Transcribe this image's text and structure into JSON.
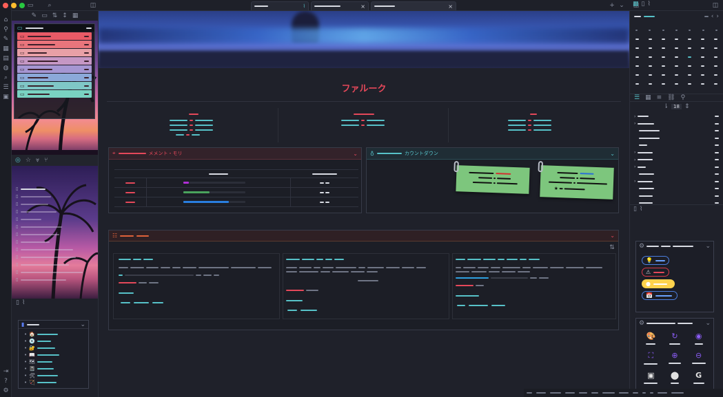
{
  "window": {
    "traffic_lights": [
      "#ff5f57",
      "#febc2e",
      "#28c840"
    ]
  },
  "rail_icons": [
    "home-icon",
    "graph-icon",
    "edit-icon",
    "calendar-icon",
    "book-icon",
    "globe-icon",
    "search-icon",
    "database-icon",
    "clipboard-icon"
  ],
  "rail_bottom_icons": [
    "vault-icon",
    "help-icon",
    "settings-icon"
  ],
  "sidebar": {
    "folder_colors": [
      "#e85a66",
      "#e9757c",
      "#e8a0a6",
      "#c597c4",
      "#a596d2",
      "#8ba9d9",
      "#7fc7c7",
      "#79d2c1"
    ],
    "toolbar_icons": [
      "📝",
      "🗂",
      "🔀",
      "↕",
      "📑"
    ],
    "bookmarks_emoji": [
      "🏠",
      "💿",
      "🔐",
      "📖",
      "🗺",
      "📓",
      "🛠",
      "🏹"
    ]
  },
  "main": {
    "title": "ファルーク",
    "panel_memory_title": "メメント・モリ",
    "panel_countdown_title": "カウントダウン",
    "memory_bar_colors": [
      "#b02fd6",
      "#4aa35d",
      "#2a7fe0"
    ]
  },
  "right": {
    "line_number_value": "18"
  }
}
